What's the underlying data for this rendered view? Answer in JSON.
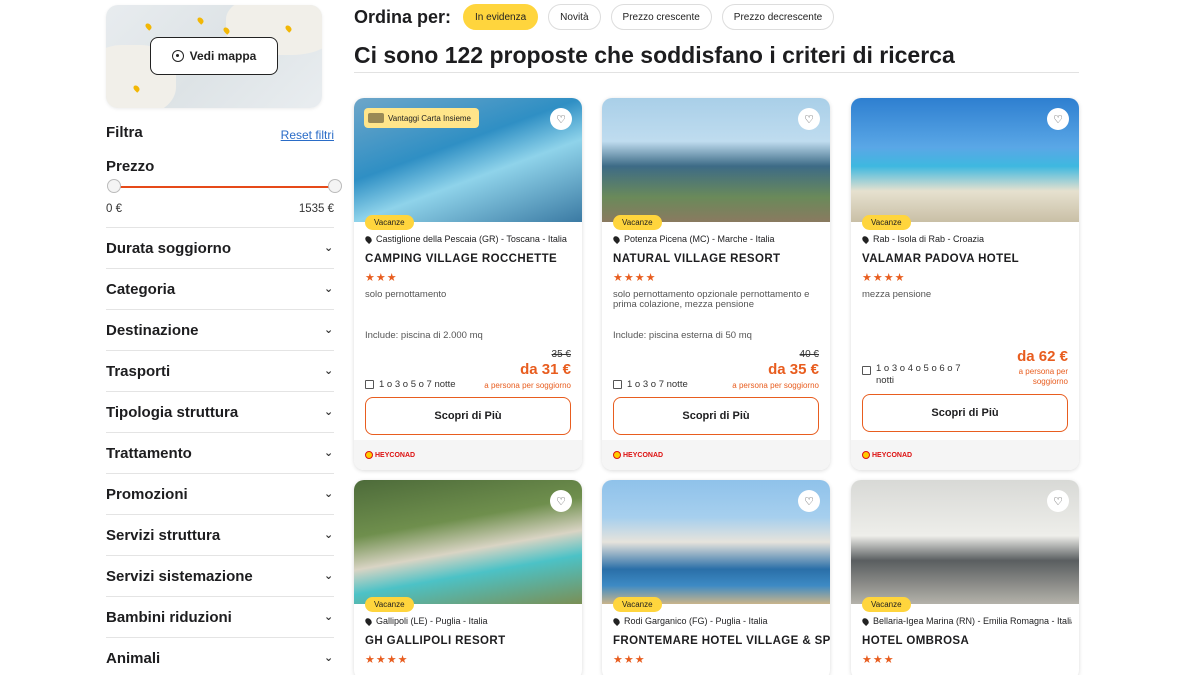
{
  "sidebar": {
    "map_button": "Vedi mappa",
    "filter_title": "Filtra",
    "reset_label": "Reset filtri",
    "price_title": "Prezzo",
    "price_min": "0 €",
    "price_max": "1535 €",
    "facets": [
      "Durata soggiorno",
      "Categoria",
      "Destinazione",
      "Trasporti",
      "Tipologia struttura",
      "Trattamento",
      "Promozioni",
      "Servizi struttura",
      "Servizi sistemazione",
      "Bambini riduzioni",
      "Animali"
    ]
  },
  "sort": {
    "label": "Ordina per:",
    "options": [
      "In evidenza",
      "Novità",
      "Prezzo crescente",
      "Prezzo decrescente"
    ],
    "active_index": 0
  },
  "headline": "Ci sono 122 proposte che soddisfano i criteri di ricerca",
  "colors": {
    "accent": "#e85d1f",
    "tag": "#ffd53d"
  },
  "cards": [
    {
      "promo": "Vantaggi Carta Insieme",
      "tag": "Vacanze",
      "location": "Castiglione della Pescaia (GR) - Toscana - Italia",
      "name": "CAMPING VILLAGE ROCCHETTE",
      "stars": "★★★",
      "treatment": "solo pernottamento",
      "include": "Include: piscina di 2.000 mq",
      "nights": "1 o 3 o 5 o 7 notte",
      "old_price": "35 €",
      "price": "da 31 €",
      "per": "a persona per soggiorno",
      "cta": "Scopri di Più",
      "logo": "HEYCONAD"
    },
    {
      "tag": "Vacanze",
      "location": "Potenza Picena (MC) - Marche - Italia",
      "name": "NATURAL VILLAGE RESORT",
      "stars": "★★★★",
      "treatment": "solo pernottamento opzionale pernottamento e prima colazione, mezza pensione",
      "include": "Include: piscina esterna di 50 mq",
      "nights": "1 o 3 o 7 notte",
      "old_price": "40 €",
      "price": "da 35 €",
      "per": "a persona per soggiorno",
      "cta": "Scopri di Più",
      "logo": "HEYCONAD"
    },
    {
      "tag": "Vacanze",
      "location": "Rab - Isola di Rab - Croazia",
      "name": "VALAMAR PADOVA HOTEL",
      "stars": "★★★★",
      "treatment": "mezza pensione",
      "nights": "1 o 3 o 4 o 5 o 6 o 7 notti",
      "price": "da 62 €",
      "per": "a persona per soggiorno",
      "cta": "Scopri di Più",
      "logo": "HEYCONAD"
    },
    {
      "tag": "Vacanze",
      "location": "Gallipoli (LE) - Puglia - Italia",
      "name": "GH GALLIPOLI RESORT",
      "stars": "★★★★"
    },
    {
      "tag": "Vacanze",
      "location": "Rodi Garganico (FG) - Puglia - Italia",
      "name": "FRONTEMARE HOTEL VILLAGE & SPA",
      "stars": "★★★"
    },
    {
      "tag": "Vacanze",
      "location": "Bellaria-Igea Marina (RN) - Emilia Romagna - Italia",
      "name": "HOTEL OMBROSA",
      "stars": "★★★"
    }
  ]
}
